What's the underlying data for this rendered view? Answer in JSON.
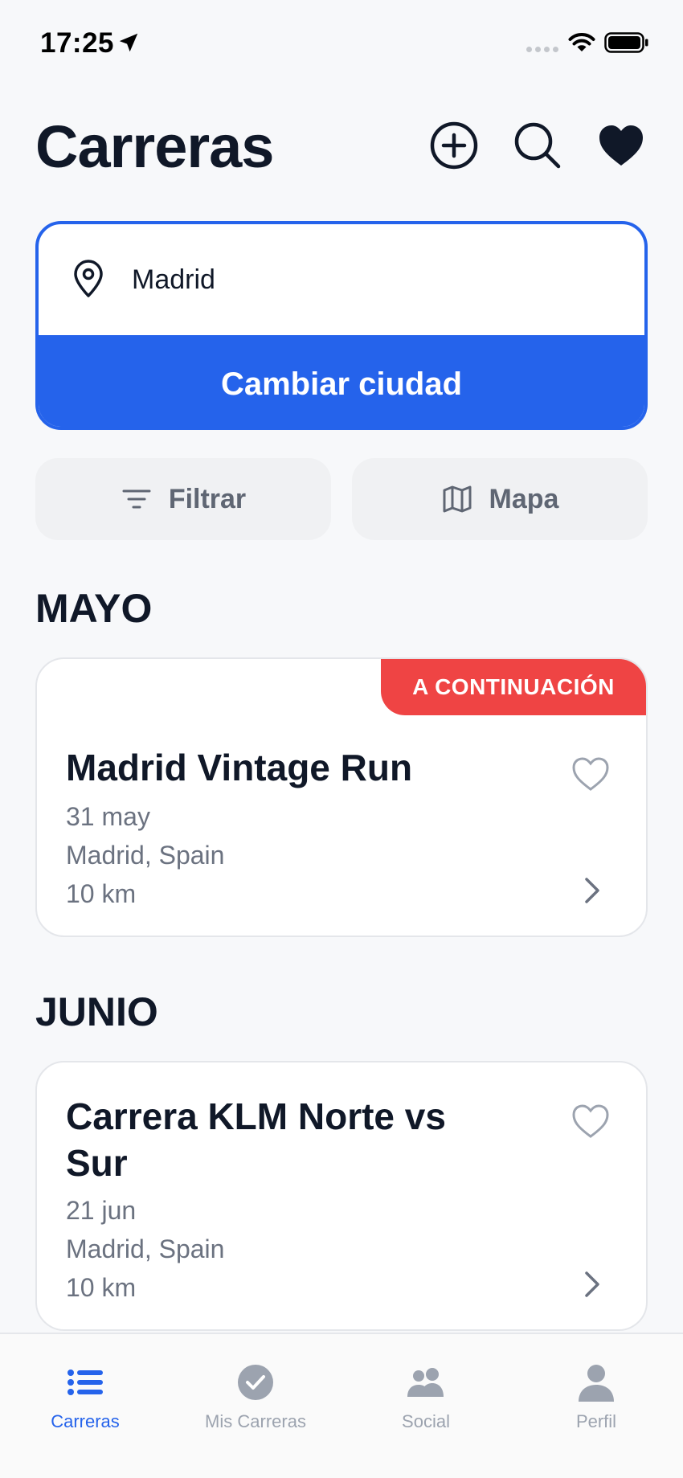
{
  "status_bar": {
    "time": "17:25"
  },
  "header": {
    "title": "Carreras"
  },
  "city": {
    "value": "Madrid",
    "change_label": "Cambiar ciudad"
  },
  "filters": {
    "filter_label": "Filtrar",
    "map_label": "Mapa"
  },
  "sections": [
    {
      "title": "MAYO"
    },
    {
      "title": "JUNIO"
    }
  ],
  "races": [
    {
      "badge": "A CONTINUACIÓN",
      "name": "Madrid Vintage Run",
      "date": "31 may",
      "location": "Madrid, Spain",
      "distance": "10 km"
    },
    {
      "name": "Carrera KLM Norte vs Sur",
      "date": "21 jun",
      "location": "Madrid, Spain",
      "distance": "10 km"
    }
  ],
  "tabs": [
    {
      "label": "Carreras",
      "icon": "list-icon"
    },
    {
      "label": "Mis Carreras",
      "icon": "check-circle-icon"
    },
    {
      "label": "Social",
      "icon": "people-icon"
    },
    {
      "label": "Perfil",
      "icon": "person-icon"
    }
  ],
  "colors": {
    "accent": "#2563eb",
    "badge": "#ef4444",
    "text": "#101828",
    "muted": "#6b7280"
  }
}
